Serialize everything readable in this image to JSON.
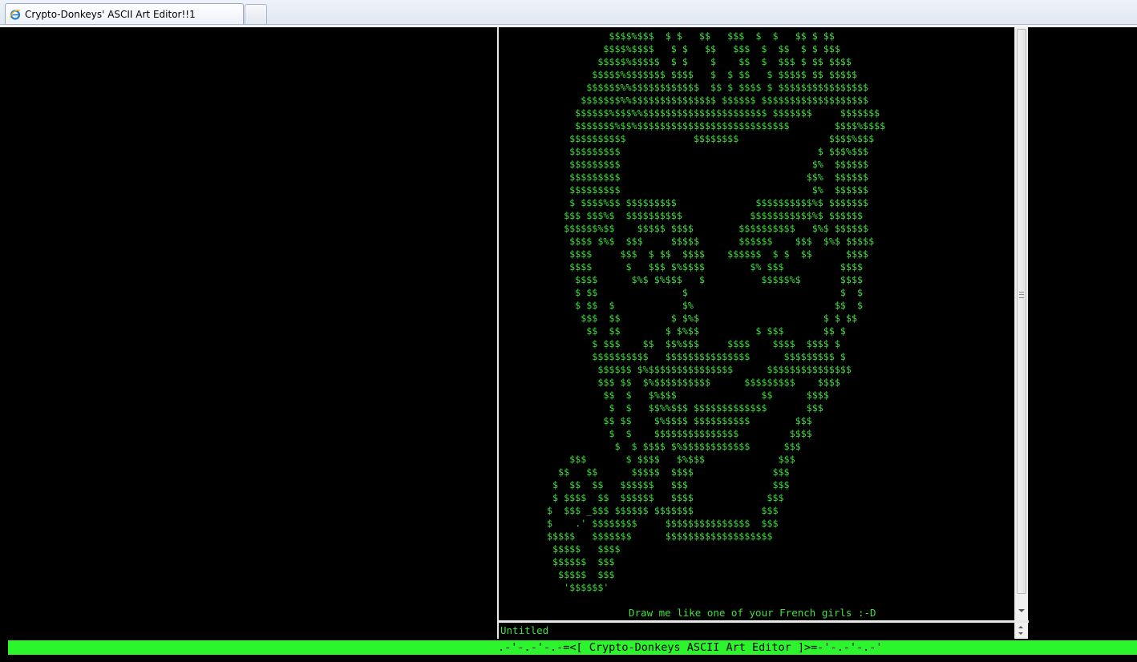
{
  "browser": {
    "tab_title": "Crypto-Donkeys' ASCII Art Editor!!1",
    "tab_icon": "internet-explorer-icon"
  },
  "editor": {
    "art": "           $$$$%$$$  $ $   $$   $$$  $  $   $$ $ $$\n          $$$$%$$$$   $ $   $$   $$$  $  $$  $ $ $$$\n         $$$$$%$$$$$  $ $    $    $$  $  $$$ $ $$ $$$$\n        $$$$$%$$$$$$$ $$$$   $  $ $$   $ $$$$$ $$ $$$$$\n       $$$$$$%%$$$$$$$$$$$$  $$ $ $$$$ $ $$$$$$$$$$$$$$$$\n      $$$$$$$%%$$$$$$$$$$$$$$$ $$$$$$ $$$$$$$$$$$$$$$$$$$\n     $$$$$$%$$$%%$$$$$$$$$$$$$$$$$$$$$$ $$$$$$$     $$$$$$$\n     $$$$$$$%$$%$$$$$$$$$$$$$$$$$$$$$$$$$$$        $$$$%$$$$\n    $$$$$$$$$$            $$$$$$$$                $$$$%$$$\n    $$$$$$$$$                                   $ $$$%$$$\n    $$$$$$$$$                                  $%  $$$$$$\n    $$$$$$$$$                                 $$%  $$$$$$\n    $$$$$$$$$                                  $%  $$$$$$\n    $ $$$$%$$ $$$$$$$$$              $$$$$$$$$$%$ $$$$$$$\n   $$$ $$$%$  $$$$$$$$$$            $$$$$$$$$$$%$ $$$$$$\n   $$$$$$%$$    $$$$$ $$$$        $$$$$$$$$$   $%$ $$$$$$\n    $$$$ $%$  $$$     $$$$$       $$$$$$    $$$  $%$ $$$$$\n    $$$$     $$$  $ $$  $$$$    $$$$$$  $ $  $$      $$$$\n    $$$$      $   $$$ $%$$$$        $% $$$          $$$$\n     $$$$      $%$ $%$$$   $          $$$$$%$       $$$$\n     $ $$               $                           $  $\n     $ $$  $            $%                         $$  $\n      $$$  $$         $ $%$                      $ $ $$\n       $$  $$        $ $%$$          $ $$$       $$ $\n        $ $$$    $$  $$%$$$     $$$$    $$$$  $$$$ $\n        $$$$$$$$$$   $$$$$$$$$$$$$$$      $$$$$$$$$ $\n         $$$$$$ $%$$$$$$$$$$$$$$$      $$$$$$$$$$$$$$$\n         $$$ $$  $%$$$$$$$$$$      $$$$$$$$$    $$$$\n          $$  $   $%$$$               $$      $$$$\n           $  $   $$%%$$$ $$$$$$$$$$$$$       $$$\n          $$ $$    $%$$$$ $$$$$$$$$$        $$$\n           $  $    $$$$$$$$$$$$$$$         $$$$\n            $  $ $$$$ $%$$$$$$$$$$$$      $$$\n    $$$       $ $$$$   $%$$$             $$$\n  $$   $$      $$$$$  $$$$              $$$\n $  $$  $$   $$$$$$   $$$               $$$\n $ $$$$  $$  $$$$$$   $$$$             $$$\n$  $$$ _$$$ $$$$$$ $$$$$$$            $$$\n$    .' $$$$$$$$     $$$$$$$$$$$$$$$  $$$\n$$$$$   $$$$$$$      $$$$$$$$$$$$$$$$$$$\n $$$$$   $$$$\n $$$$$$  $$$\n  $$$$$  $$$\n   '$$$$$$'",
    "caption": "Draw me like one of your French girls :-D",
    "filename": "Untitled"
  },
  "status": {
    "banner": ".-'-.-'-.-=<[ Crypto-Donkeys ASCII Art Editor ]>=-'-.-'-.-'"
  },
  "colors": {
    "text_green": "#3fe03f",
    "status_green": "#2df52d",
    "background": "#000000"
  }
}
